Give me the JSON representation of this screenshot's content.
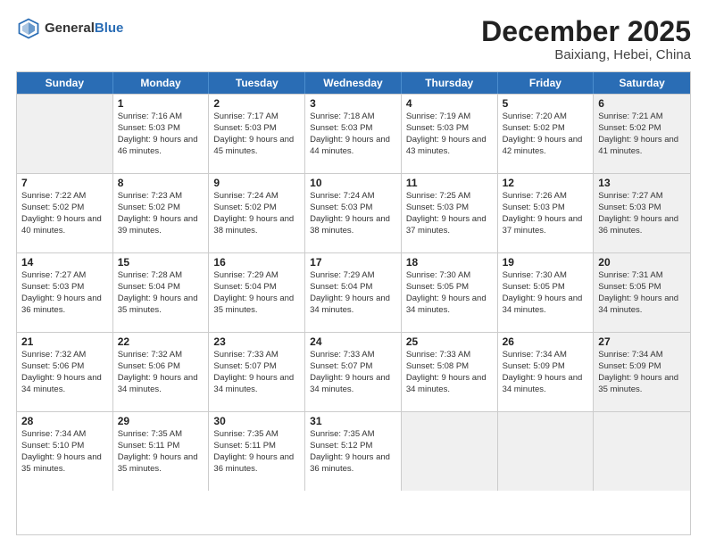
{
  "header": {
    "logo_general": "General",
    "logo_blue": "Blue",
    "month_title": "December 2025",
    "location": "Baixiang, Hebei, China"
  },
  "days_of_week": [
    "Sunday",
    "Monday",
    "Tuesday",
    "Wednesday",
    "Thursday",
    "Friday",
    "Saturday"
  ],
  "weeks": [
    [
      {
        "day": "",
        "info": "",
        "shaded": true
      },
      {
        "day": "1",
        "info": "Sunrise: 7:16 AM\nSunset: 5:03 PM\nDaylight: 9 hours\nand 46 minutes.",
        "shaded": false
      },
      {
        "day": "2",
        "info": "Sunrise: 7:17 AM\nSunset: 5:03 PM\nDaylight: 9 hours\nand 45 minutes.",
        "shaded": false
      },
      {
        "day": "3",
        "info": "Sunrise: 7:18 AM\nSunset: 5:03 PM\nDaylight: 9 hours\nand 44 minutes.",
        "shaded": false
      },
      {
        "day": "4",
        "info": "Sunrise: 7:19 AM\nSunset: 5:03 PM\nDaylight: 9 hours\nand 43 minutes.",
        "shaded": false
      },
      {
        "day": "5",
        "info": "Sunrise: 7:20 AM\nSunset: 5:02 PM\nDaylight: 9 hours\nand 42 minutes.",
        "shaded": false
      },
      {
        "day": "6",
        "info": "Sunrise: 7:21 AM\nSunset: 5:02 PM\nDaylight: 9 hours\nand 41 minutes.",
        "shaded": true
      }
    ],
    [
      {
        "day": "7",
        "info": "Sunrise: 7:22 AM\nSunset: 5:02 PM\nDaylight: 9 hours\nand 40 minutes.",
        "shaded": false
      },
      {
        "day": "8",
        "info": "Sunrise: 7:23 AM\nSunset: 5:02 PM\nDaylight: 9 hours\nand 39 minutes.",
        "shaded": false
      },
      {
        "day": "9",
        "info": "Sunrise: 7:24 AM\nSunset: 5:02 PM\nDaylight: 9 hours\nand 38 minutes.",
        "shaded": false
      },
      {
        "day": "10",
        "info": "Sunrise: 7:24 AM\nSunset: 5:03 PM\nDaylight: 9 hours\nand 38 minutes.",
        "shaded": false
      },
      {
        "day": "11",
        "info": "Sunrise: 7:25 AM\nSunset: 5:03 PM\nDaylight: 9 hours\nand 37 minutes.",
        "shaded": false
      },
      {
        "day": "12",
        "info": "Sunrise: 7:26 AM\nSunset: 5:03 PM\nDaylight: 9 hours\nand 37 minutes.",
        "shaded": false
      },
      {
        "day": "13",
        "info": "Sunrise: 7:27 AM\nSunset: 5:03 PM\nDaylight: 9 hours\nand 36 minutes.",
        "shaded": true
      }
    ],
    [
      {
        "day": "14",
        "info": "Sunrise: 7:27 AM\nSunset: 5:03 PM\nDaylight: 9 hours\nand 36 minutes.",
        "shaded": false
      },
      {
        "day": "15",
        "info": "Sunrise: 7:28 AM\nSunset: 5:04 PM\nDaylight: 9 hours\nand 35 minutes.",
        "shaded": false
      },
      {
        "day": "16",
        "info": "Sunrise: 7:29 AM\nSunset: 5:04 PM\nDaylight: 9 hours\nand 35 minutes.",
        "shaded": false
      },
      {
        "day": "17",
        "info": "Sunrise: 7:29 AM\nSunset: 5:04 PM\nDaylight: 9 hours\nand 34 minutes.",
        "shaded": false
      },
      {
        "day": "18",
        "info": "Sunrise: 7:30 AM\nSunset: 5:05 PM\nDaylight: 9 hours\nand 34 minutes.",
        "shaded": false
      },
      {
        "day": "19",
        "info": "Sunrise: 7:30 AM\nSunset: 5:05 PM\nDaylight: 9 hours\nand 34 minutes.",
        "shaded": false
      },
      {
        "day": "20",
        "info": "Sunrise: 7:31 AM\nSunset: 5:05 PM\nDaylight: 9 hours\nand 34 minutes.",
        "shaded": true
      }
    ],
    [
      {
        "day": "21",
        "info": "Sunrise: 7:32 AM\nSunset: 5:06 PM\nDaylight: 9 hours\nand 34 minutes.",
        "shaded": false
      },
      {
        "day": "22",
        "info": "Sunrise: 7:32 AM\nSunset: 5:06 PM\nDaylight: 9 hours\nand 34 minutes.",
        "shaded": false
      },
      {
        "day": "23",
        "info": "Sunrise: 7:33 AM\nSunset: 5:07 PM\nDaylight: 9 hours\nand 34 minutes.",
        "shaded": false
      },
      {
        "day": "24",
        "info": "Sunrise: 7:33 AM\nSunset: 5:07 PM\nDaylight: 9 hours\nand 34 minutes.",
        "shaded": false
      },
      {
        "day": "25",
        "info": "Sunrise: 7:33 AM\nSunset: 5:08 PM\nDaylight: 9 hours\nand 34 minutes.",
        "shaded": false
      },
      {
        "day": "26",
        "info": "Sunrise: 7:34 AM\nSunset: 5:09 PM\nDaylight: 9 hours\nand 34 minutes.",
        "shaded": false
      },
      {
        "day": "27",
        "info": "Sunrise: 7:34 AM\nSunset: 5:09 PM\nDaylight: 9 hours\nand 35 minutes.",
        "shaded": true
      }
    ],
    [
      {
        "day": "28",
        "info": "Sunrise: 7:34 AM\nSunset: 5:10 PM\nDaylight: 9 hours\nand 35 minutes.",
        "shaded": false
      },
      {
        "day": "29",
        "info": "Sunrise: 7:35 AM\nSunset: 5:11 PM\nDaylight: 9 hours\nand 35 minutes.",
        "shaded": false
      },
      {
        "day": "30",
        "info": "Sunrise: 7:35 AM\nSunset: 5:11 PM\nDaylight: 9 hours\nand 36 minutes.",
        "shaded": false
      },
      {
        "day": "31",
        "info": "Sunrise: 7:35 AM\nSunset: 5:12 PM\nDaylight: 9 hours\nand 36 minutes.",
        "shaded": false
      },
      {
        "day": "",
        "info": "",
        "shaded": true
      },
      {
        "day": "",
        "info": "",
        "shaded": true
      },
      {
        "day": "",
        "info": "",
        "shaded": true
      }
    ]
  ]
}
